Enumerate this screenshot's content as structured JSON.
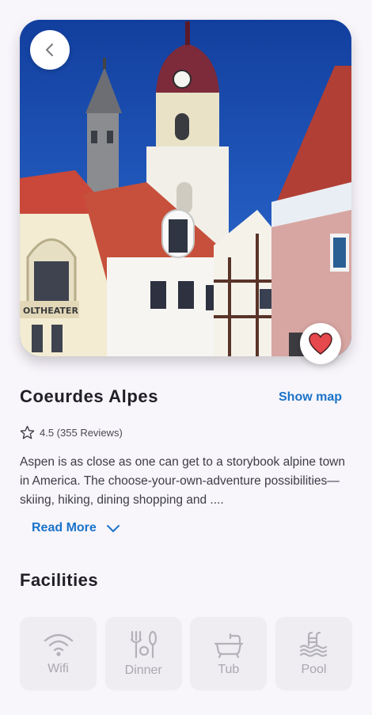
{
  "place": {
    "name": "Coeurdes Alpes",
    "show_map_label": "Show map",
    "rating_text": "4.5 (355 Reviews)",
    "description": "Aspen is as close as one can get to a storybook alpine town in America. The choose-your-own-adventure possibilities—skiing, hiking, dining shopping and ....",
    "read_more_label": "Read More",
    "hero_sign_text": "OLTHEATER"
  },
  "facilities": {
    "title": "Facilities",
    "items": [
      {
        "label": "Wifi",
        "icon": "wifi-icon"
      },
      {
        "label": "Dinner",
        "icon": "dinner-icon"
      },
      {
        "label": "Tub",
        "icon": "tub-icon"
      },
      {
        "label": "Pool",
        "icon": "pool-icon"
      }
    ]
  },
  "colors": {
    "accent": "#1a73c9",
    "heart": "#e5484d",
    "background": "#f8f5fb",
    "facility_tile": "#efedf2",
    "facility_icon": "#b3b2b8"
  },
  "icons": {
    "back": "chevron-left-icon",
    "favorite": "heart-icon",
    "rating": "star-outline-icon",
    "read_more": "chevron-down-icon"
  }
}
